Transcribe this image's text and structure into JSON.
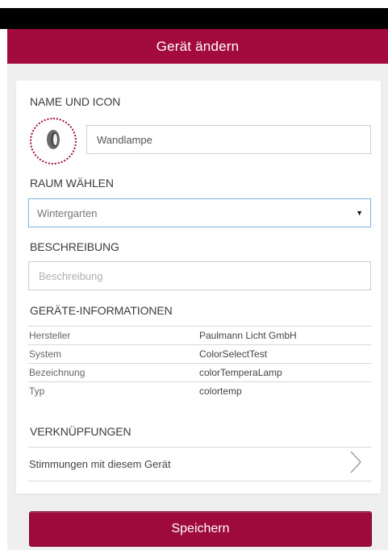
{
  "header": {
    "title": "Gerät ändern"
  },
  "name_section": {
    "label": "NAME UND ICON",
    "icon": "lamp-icon",
    "name_value": "Wandlampe"
  },
  "room_section": {
    "label": "RAUM WÄHLEN",
    "selected": "Wintergarten"
  },
  "description_section": {
    "label": "BESCHREIBUNG",
    "placeholder": "Beschreibung"
  },
  "device_info": {
    "label": "GERÄTE-INFORMATIONEN",
    "rows": [
      {
        "key": "Hersteller",
        "value": "Paulmann Licht GmbH"
      },
      {
        "key": "System",
        "value": "ColorSelectTest"
      },
      {
        "key": "Bezeichnung",
        "value": "colorTemperaLamp"
      },
      {
        "key": "Typ",
        "value": "colortemp"
      }
    ]
  },
  "links_section": {
    "label": "VERKNÜPFUNGEN",
    "item": "Stimmungen mit diesem Gerät"
  },
  "save_label": "Speichern",
  "colors": {
    "accent": "#a30b3e",
    "select_border": "#7fb3e0"
  }
}
